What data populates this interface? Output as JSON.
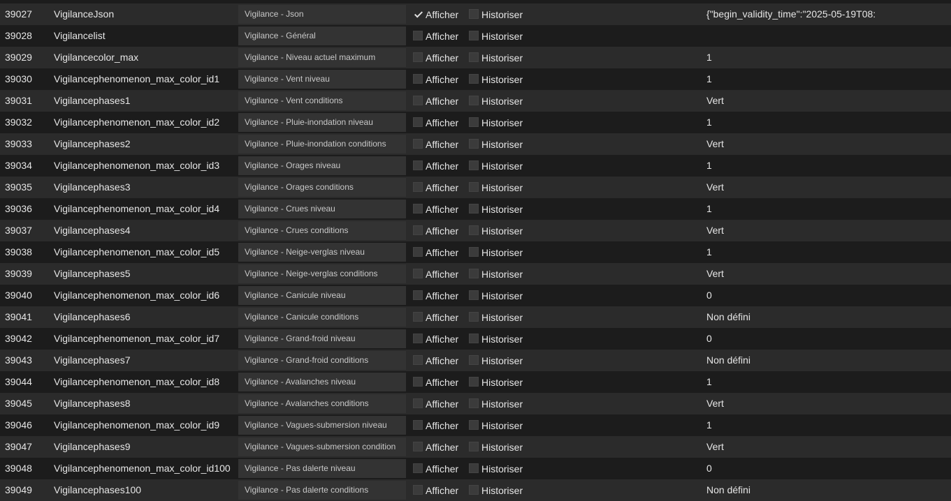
{
  "labels": {
    "show": "Afficher",
    "historize": "Historiser"
  },
  "rows": [
    {
      "id": "39027",
      "name": "VigilanceJson",
      "desc": "Vigilance - Json",
      "show": true,
      "historize": false,
      "value": "{\"begin_validity_time\":\"2025-05-19T08:"
    },
    {
      "id": "39028",
      "name": "Vigilancelist",
      "desc": "Vigilance - Général",
      "show": false,
      "historize": false,
      "value": ""
    },
    {
      "id": "39029",
      "name": "Vigilancecolor_max",
      "desc": "Vigilance - Niveau actuel maximum",
      "show": false,
      "historize": false,
      "value": "1"
    },
    {
      "id": "39030",
      "name": "Vigilancephenomenon_max_color_id1",
      "desc": "Vigilance - Vent niveau",
      "show": false,
      "historize": false,
      "value": "1"
    },
    {
      "id": "39031",
      "name": "Vigilancephases1",
      "desc": "Vigilance - Vent conditions",
      "show": false,
      "historize": false,
      "value": "Vert"
    },
    {
      "id": "39032",
      "name": "Vigilancephenomenon_max_color_id2",
      "desc": "Vigilance - Pluie-inondation niveau",
      "show": false,
      "historize": false,
      "value": "1"
    },
    {
      "id": "39033",
      "name": "Vigilancephases2",
      "desc": "Vigilance - Pluie-inondation conditions",
      "show": false,
      "historize": false,
      "value": "Vert"
    },
    {
      "id": "39034",
      "name": "Vigilancephenomenon_max_color_id3",
      "desc": "Vigilance - Orages niveau",
      "show": false,
      "historize": false,
      "value": "1"
    },
    {
      "id": "39035",
      "name": "Vigilancephases3",
      "desc": "Vigilance - Orages conditions",
      "show": false,
      "historize": false,
      "value": "Vert"
    },
    {
      "id": "39036",
      "name": "Vigilancephenomenon_max_color_id4",
      "desc": "Vigilance - Crues niveau",
      "show": false,
      "historize": false,
      "value": "1"
    },
    {
      "id": "39037",
      "name": "Vigilancephases4",
      "desc": "Vigilance - Crues conditions",
      "show": false,
      "historize": false,
      "value": "Vert"
    },
    {
      "id": "39038",
      "name": "Vigilancephenomenon_max_color_id5",
      "desc": "Vigilance - Neige-verglas niveau",
      "show": false,
      "historize": false,
      "value": "1"
    },
    {
      "id": "39039",
      "name": "Vigilancephases5",
      "desc": "Vigilance - Neige-verglas conditions",
      "show": false,
      "historize": false,
      "value": "Vert"
    },
    {
      "id": "39040",
      "name": "Vigilancephenomenon_max_color_id6",
      "desc": "Vigilance - Canicule niveau",
      "show": false,
      "historize": false,
      "value": "0"
    },
    {
      "id": "39041",
      "name": "Vigilancephases6",
      "desc": "Vigilance - Canicule conditions",
      "show": false,
      "historize": false,
      "value": "Non défini"
    },
    {
      "id": "39042",
      "name": "Vigilancephenomenon_max_color_id7",
      "desc": "Vigilance - Grand-froid niveau",
      "show": false,
      "historize": false,
      "value": "0"
    },
    {
      "id": "39043",
      "name": "Vigilancephases7",
      "desc": "Vigilance - Grand-froid conditions",
      "show": false,
      "historize": false,
      "value": "Non défini"
    },
    {
      "id": "39044",
      "name": "Vigilancephenomenon_max_color_id8",
      "desc": "Vigilance - Avalanches niveau",
      "show": false,
      "historize": false,
      "value": "1"
    },
    {
      "id": "39045",
      "name": "Vigilancephases8",
      "desc": "Vigilance - Avalanches conditions",
      "show": false,
      "historize": false,
      "value": "Vert"
    },
    {
      "id": "39046",
      "name": "Vigilancephenomenon_max_color_id9",
      "desc": "Vigilance - Vagues-submersion niveau",
      "show": false,
      "historize": false,
      "value": "1"
    },
    {
      "id": "39047",
      "name": "Vigilancephases9",
      "desc": "Vigilance - Vagues-submersion condition",
      "show": false,
      "historize": false,
      "value": "Vert"
    },
    {
      "id": "39048",
      "name": "Vigilancephenomenon_max_color_id100",
      "desc": "Vigilance - Pas dalerte niveau",
      "show": false,
      "historize": false,
      "value": "0"
    },
    {
      "id": "39049",
      "name": "Vigilancephases100",
      "desc": "Vigilance - Pas dalerte conditions",
      "show": false,
      "historize": false,
      "value": "Non défini"
    }
  ]
}
